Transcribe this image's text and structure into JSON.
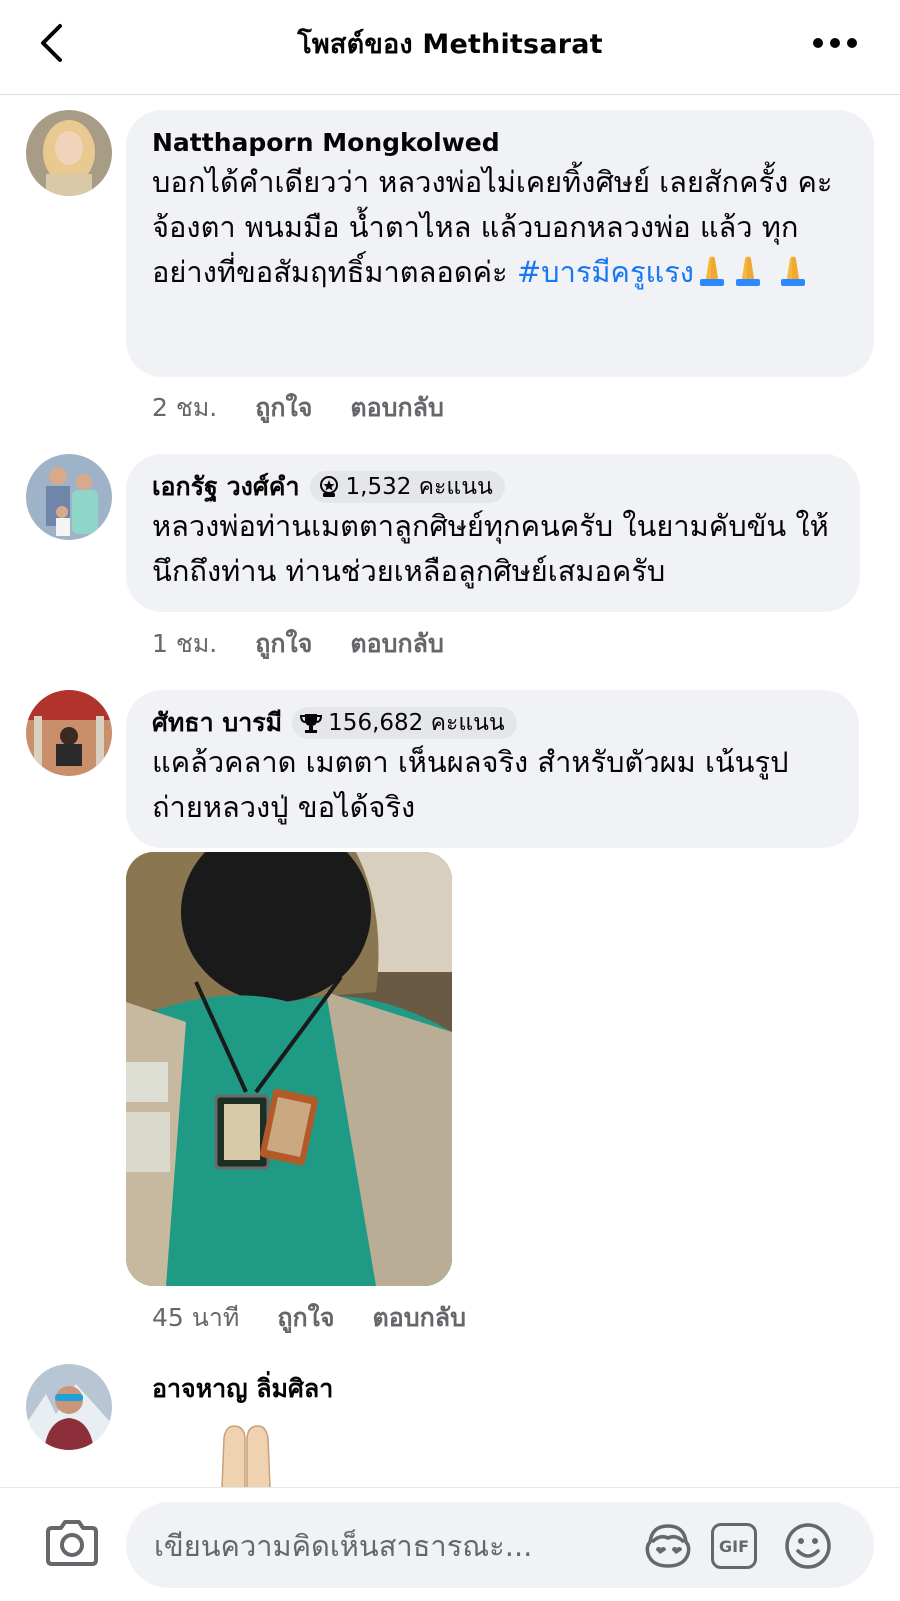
{
  "header": {
    "title": "โพสต์ของ Methitsarat",
    "back_icon": "chevron-left-icon",
    "more_icon": "more-horizontal-icon"
  },
  "comments": [
    {
      "author": "Natthaporn Mongkolwed",
      "text": "บอกได้คำเดียวว่า หลวงพ่อไม่เคยทิ้งศิษย์ เลยสักครั้ง คะ จ้องตา พนมมือ น้ำตาไหล แล้วบอกหลวงพ่อ แล้ว ทุกอย่างที่ขอสัมฤทธิ์มาตลอดค่ะ",
      "hashtag": "#บารมีครูแรง",
      "emoji": "folded-hands-icon",
      "time": "2 ชม.",
      "like": "ถูกใจ",
      "reply": "ตอบกลับ"
    },
    {
      "author": "เอกรัฐ วงศ์คำ",
      "badge_icon": "rising-fan-icon",
      "badge": "1,532 คะแนน",
      "text": "หลวงพ่อท่านเมตตาลูกศิษย์ทุกคนครับ  ในยามคับขัน ให้นึกถึงท่าน ท่านช่วยเหลือลูกศิษย์เสมอครับ",
      "time": "1 ชม.",
      "like": "ถูกใจ",
      "reply": "ตอบกลับ"
    },
    {
      "author": "ศัทธา บารมี",
      "badge_icon": "trophy-icon",
      "badge": "156,682 คะแนน",
      "text": "แคล้วคลาด เมตตา  เห็นผลจริง สำหรับตัวผม เน้นรูป ถ่ายหลวงปู่ ขอได้จริง",
      "time": "45 นาที",
      "like": "ถูกใจ",
      "reply": "ตอบกลับ"
    },
    {
      "author": "อาจหาญ ลิ่มศิลา",
      "sticker": "folded-hands-icon"
    }
  ],
  "composer": {
    "placeholder": "เขียนความคิดเห็นสาธารณะ...",
    "camera_icon": "camera-icon",
    "avatar_icon": "avatar-sticker-icon",
    "gif_label": "GIF",
    "emoji_icon": "smiley-icon"
  },
  "colors": {
    "link": "#1877f2",
    "bubble": "#f0f2f5",
    "meta": "#65676b"
  }
}
